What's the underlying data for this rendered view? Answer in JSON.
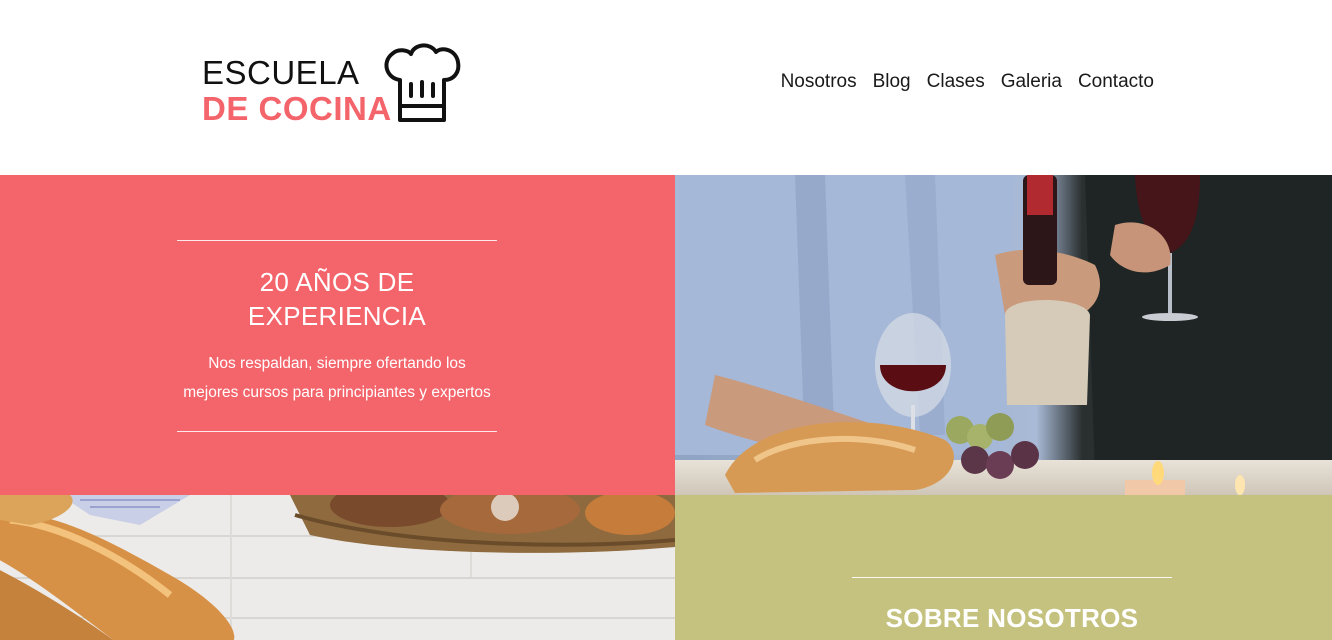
{
  "brand": {
    "line1": "ESCUELA",
    "line2": "DE COCINA",
    "accent_color": "#f4646b"
  },
  "nav": {
    "items": [
      "Nosotros",
      "Blog",
      "Clases",
      "Galeria",
      "Contacto"
    ]
  },
  "hero": {
    "title_line1": "20 AÑOS DE",
    "title_line2": "EXPERIENCIA",
    "text_line1": "Nos respaldan, siempre ofertando los",
    "text_line2": "mejores cursos para principiantes y expertos",
    "bg_color": "#f4646b"
  },
  "about": {
    "title": "SOBRE NOSOTROS",
    "bg_color": "#c4c27e"
  },
  "images": {
    "wine": "wine-dinner-photo",
    "bread": "bread-basket-photo"
  }
}
